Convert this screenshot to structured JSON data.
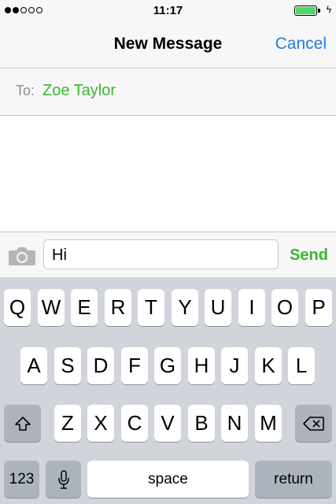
{
  "status_bar": {
    "time": "11:17",
    "signal_dots": [
      true,
      true,
      false,
      false,
      false
    ],
    "battery_level": 1.0,
    "battery_color": "#4cd964",
    "charging_icon": "bolt-icon"
  },
  "navigation": {
    "title": "New Message",
    "cancel_label": "Cancel",
    "accent_color": "#1c7fe0"
  },
  "recipient": {
    "to_label": "To:",
    "name": "Zoe Taylor",
    "name_color": "#3bb532"
  },
  "composer": {
    "camera_icon": "camera-icon",
    "message_text": "Hi",
    "send_label": "Send",
    "send_color": "#3bb532"
  },
  "keyboard": {
    "row1": [
      "Q",
      "W",
      "E",
      "R",
      "T",
      "Y",
      "U",
      "I",
      "O",
      "P"
    ],
    "row2": [
      "A",
      "S",
      "D",
      "F",
      "G",
      "H",
      "J",
      "K",
      "L"
    ],
    "row3": [
      "Z",
      "X",
      "C",
      "V",
      "B",
      "N",
      "M"
    ],
    "shift_icon": "shift-icon",
    "delete_icon": "delete-icon",
    "numbers_label": "123",
    "mic_icon": "microphone-icon",
    "space_label": "space",
    "return_label": "return"
  }
}
